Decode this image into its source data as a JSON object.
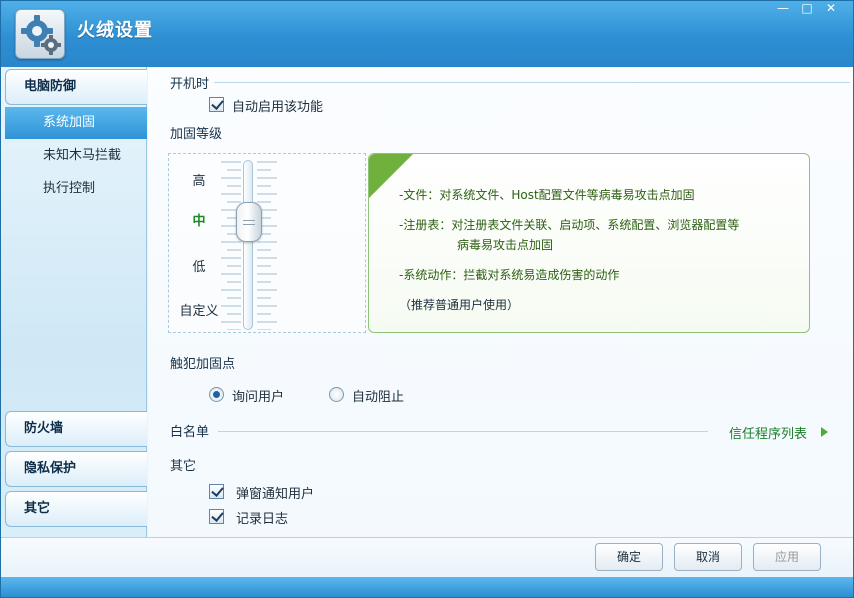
{
  "window": {
    "title": "火绒设置",
    "minimize": "—",
    "maximize": "□",
    "close": "✕"
  },
  "sidebar": {
    "sections": [
      {
        "label": "电脑防御"
      },
      {
        "label": "防火墙"
      },
      {
        "label": "隐私保护"
      },
      {
        "label": "其它"
      }
    ],
    "items": [
      {
        "label": "系统加固",
        "active": true
      },
      {
        "label": "未知木马拦截"
      },
      {
        "label": "执行控制"
      }
    ]
  },
  "boot": {
    "heading": "开机时",
    "auto_enable": "自动启用该功能",
    "checked": true
  },
  "hardening": {
    "heading": "加固等级",
    "levels": [
      "高",
      "中",
      "低",
      "自定义"
    ],
    "selected": "中",
    "info": [
      "-文件：对系统文件、Host配置文件等病毒易攻击点加固",
      "-注册表：对注册表文件关联、启动项、系统配置、浏览器配置等",
      "病毒易攻击点加固",
      "-系统动作：拦截对系统易造成伤害的动作",
      "（推荐普通用户使用）"
    ]
  },
  "trigger": {
    "heading": "触犯加固点",
    "options": [
      "询问用户",
      "自动阻止"
    ],
    "selected": "询问用户"
  },
  "whitelist": {
    "heading": "白名单",
    "link": "信任程序列表"
  },
  "other": {
    "heading": "其它",
    "options": [
      "弹窗通知用户",
      "记录日志"
    ]
  },
  "buttons": {
    "ok": "确定",
    "cancel": "取消",
    "apply": "应用"
  }
}
